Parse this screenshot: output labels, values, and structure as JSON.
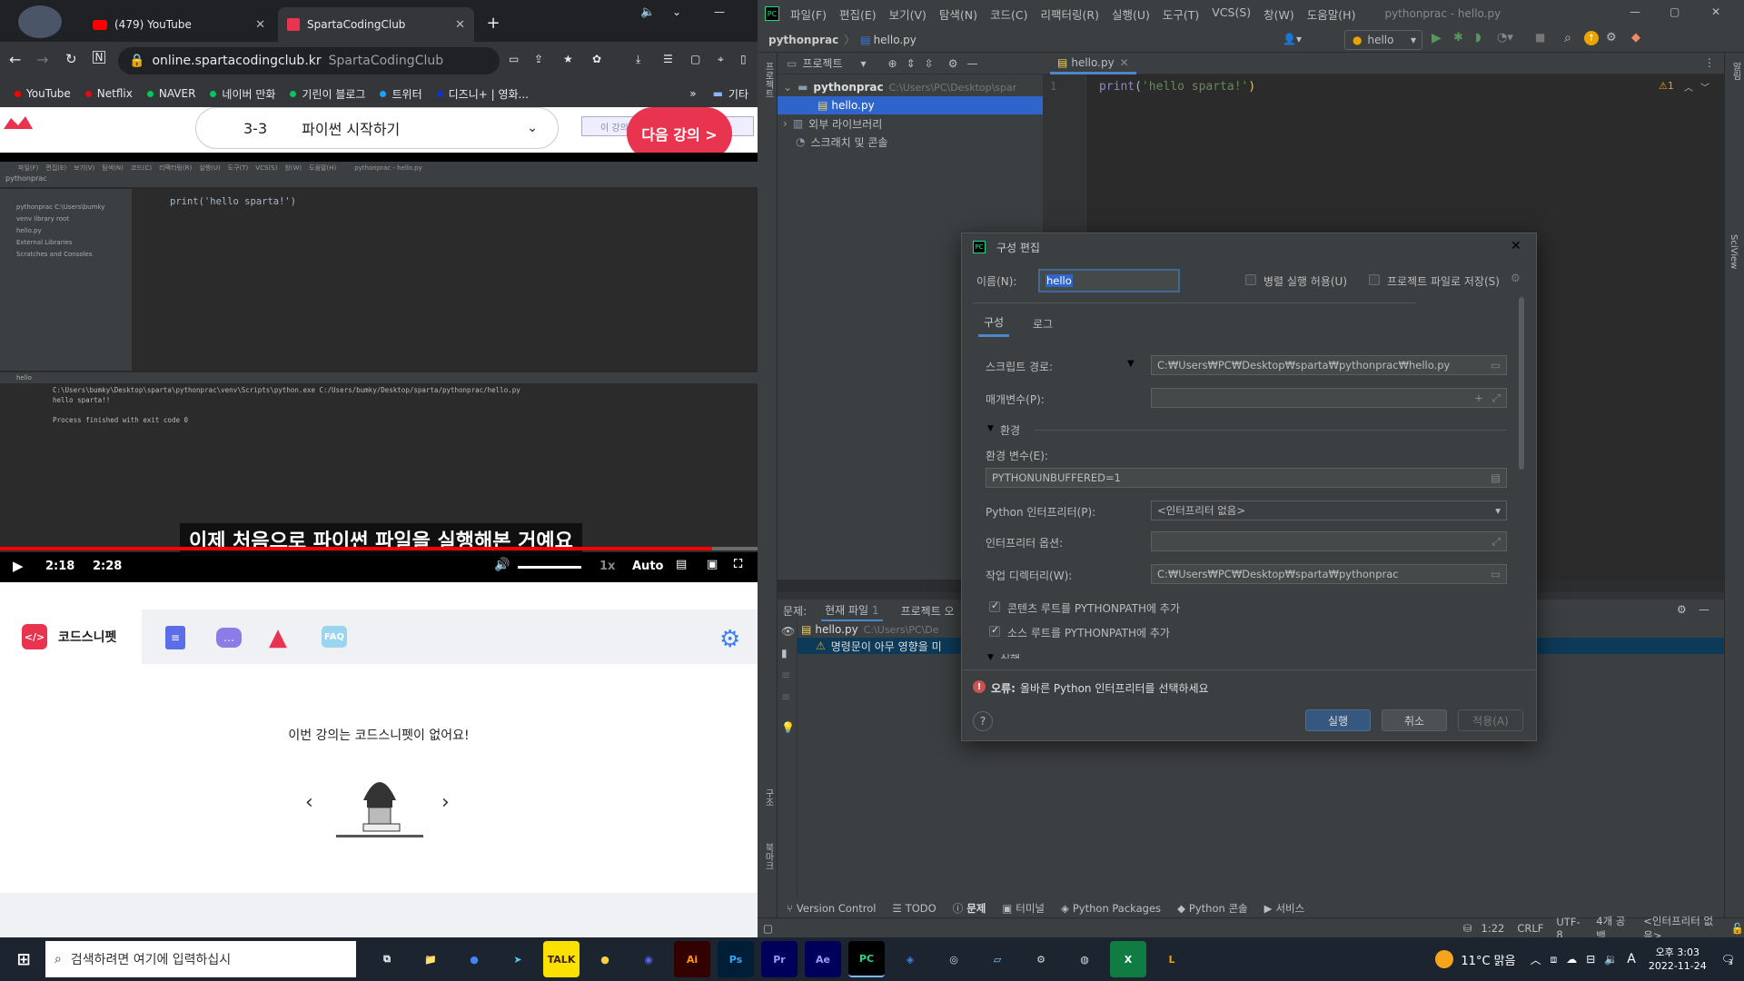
{
  "browser": {
    "tabs": [
      {
        "label": "(479) YouTube"
      },
      {
        "label": "SpartaCodingClub"
      }
    ],
    "url": "online.spartacodingclub.kr",
    "url_suffix": "SpartaCodingClub",
    "bookmarks": [
      {
        "label": "YouTube",
        "color": "#ff0000"
      },
      {
        "label": "Netflix",
        "color": "#e50914"
      },
      {
        "label": "NAVER",
        "color": "#03c75a"
      },
      {
        "label": "네이버 만화",
        "color": "#03c75a"
      },
      {
        "label": "기린이 블로그",
        "color": "#03c75a"
      },
      {
        "label": "트위터",
        "color": "#1da1f2"
      },
      {
        "label": "디즈니+ | 영화...",
        "color": "#1133cc"
      }
    ],
    "bookmark_more": "기타"
  },
  "lecture": {
    "number": "3-3",
    "title": "파이썬 시작하기",
    "next_label": "다음 강의 >",
    "banner_text": "이 강의를 내려받기 동영상"
  },
  "video": {
    "subtitle": "이제 처음으로 파이썬 파일을 실행해본 거예요",
    "time_current": "2:18",
    "time_total": "2:28",
    "speed": "1x",
    "quality": "Auto",
    "progress": 0.94,
    "inner": {
      "menu": [
        "파일(F)",
        "편집(E)",
        "보기(V)",
        "탐색(N)",
        "코드(C)",
        "리팩터링(R)",
        "실행(U)",
        "도구(T)",
        "VCS(S)",
        "창(W)",
        "도움말(H)"
      ],
      "window_title": "pythonprac - hello.py",
      "project": "pythonprac",
      "file": "hello.py",
      "tree": [
        "pythonprac  C:\\Users\\bumky",
        "venv  library root",
        "hello.py",
        "External Libraries",
        "Scratches and Consoles"
      ],
      "code_line": "print('hello sparta!')",
      "run_tab": "hello",
      "run_output": [
        "C:\\Users\\bumky\\Desktop\\sparta\\pythonprac\\venv\\Scripts\\python.exe C:/Users/bumky/Desktop/sparta/pythonprac/hello.py",
        "hello sparta!!",
        "",
        "Process finished with exit code 0"
      ]
    }
  },
  "snippet": {
    "tab_label": "코드스니펫",
    "tab_faq": "FAQ",
    "message": "이번 강의는 코드스니펫이 없어요!"
  },
  "ide": {
    "menu": [
      "파일(F)",
      "편집(E)",
      "보기(V)",
      "탐색(N)",
      "코드(C)",
      "리팩터링(R)",
      "실행(U)",
      "도구(T)",
      "VCS(S)",
      "창(W)",
      "도움말(H)"
    ],
    "window_title": "pythonprac - hello.py",
    "breadcrumb": [
      "pythonprac",
      "hello.py"
    ],
    "run_config": "hello",
    "project_tab": "프로젝트",
    "file_tab": "hello.py",
    "tree": [
      {
        "label": "pythonprac",
        "hint": "C:\\Users\\PC\\Desktop\\spar"
      },
      {
        "label": "hello.py",
        "hint": ""
      },
      {
        "label": "외부 라이브러리",
        "hint": ""
      },
      {
        "label": "스크래치 및 콘솔",
        "hint": ""
      }
    ],
    "code": {
      "line_no": "1",
      "text": "print('hello sparta!')",
      "warn": "⚠1"
    },
    "side_left": [
      "프로젝트",
      "구조",
      "북마크"
    ],
    "side_right": [
      "알림",
      "SciView"
    ],
    "problems": {
      "label": "문제:",
      "tabs": [
        "현재 파일",
        "프로젝트 오"
      ],
      "tab_count": "1",
      "file": "hello.py",
      "file_hint": "C:\\Users\\PC\\De",
      "warning": "명령문이 아무 영향을 미"
    },
    "bottom_tools": [
      "Version Control",
      "TODO",
      "문제",
      "터미널",
      "Python Packages",
      "Python 콘솔",
      "서비스"
    ],
    "status": [
      "1:22",
      "CRLF",
      "UTF-8",
      "4개 공백",
      "<인터프리터 없음>"
    ]
  },
  "dialog": {
    "title": "구성 편집",
    "name_label": "이름(N):",
    "name_value": "hello",
    "allow_parallel": "병렬 실행 허용(U)",
    "store_project": "프로젝트 파일로 저장(S)",
    "tabs": [
      "구성",
      "로그"
    ],
    "script_path_label": "스크립트 경로:",
    "script_path_value": "C:₩Users₩PC₩Desktop₩sparta₩pythonprac₩hello.py",
    "params_label": "매개변수(P):",
    "env_section": "환경",
    "env_vars_label": "환경 변수(E):",
    "env_vars_value": "PYTHONUNBUFFERED=1",
    "interpreter_label": "Python 인터프리터(P):",
    "interpreter_value": "<인터프리터 없음>",
    "interp_opts_label": "인터프리터 옵션:",
    "workdir_label": "작업 디렉터리(W):",
    "workdir_value": "C:₩Users₩PC₩Desktop₩sparta₩pythonprac",
    "content_roots": "콘텐츠 루트를 PYTHONPATH에 추가",
    "source_roots": "소스 루트를 PYTHONPATH에 추가",
    "exec_section": "실행",
    "error_prefix": "오류:",
    "error_text": "올바른 Python 인터프리터를 선택하세요",
    "run_btn": "실행",
    "cancel_btn": "취소",
    "apply_btn": "적용(A)"
  },
  "taskbar": {
    "search_placeholder": "검색하려면 여기에 입력하십시",
    "weather": "11°C 맑음",
    "time_ampm": "오후 3:03",
    "date": "2022-11-24",
    "ime": "A",
    "notif_count": "3",
    "apps": [
      {
        "name": "task-view",
        "label": "⧉",
        "bg": "transparent",
        "fg": "#fff"
      },
      {
        "name": "file-explorer",
        "label": "📁",
        "bg": "transparent",
        "fg": "#f5c242"
      },
      {
        "name": "chrome",
        "label": "●",
        "bg": "transparent",
        "fg": "#4285f4"
      },
      {
        "name": "app-bird",
        "label": "➤",
        "bg": "transparent",
        "fg": "#58c6f2"
      },
      {
        "name": "kakaotalk",
        "label": "TALK",
        "bg": "#fae100",
        "fg": "#3b1e1e"
      },
      {
        "name": "messenger",
        "label": "●",
        "bg": "transparent",
        "fg": "#f7d046"
      },
      {
        "name": "discord",
        "label": "◉",
        "bg": "transparent",
        "fg": "#5865f2"
      },
      {
        "name": "illustrator",
        "label": "Ai",
        "bg": "#330000",
        "fg": "#ff9a00"
      },
      {
        "name": "photoshop",
        "label": "Ps",
        "bg": "#001e36",
        "fg": "#31a8ff"
      },
      {
        "name": "premiere",
        "label": "Pr",
        "bg": "#00005b",
        "fg": "#9999ff"
      },
      {
        "name": "after-effects",
        "label": "Ae",
        "bg": "#00005b",
        "fg": "#9999ff"
      },
      {
        "name": "pycharm",
        "label": "PC",
        "bg": "#000",
        "fg": "#21d789"
      },
      {
        "name": "app-blue",
        "label": "◈",
        "bg": "transparent",
        "fg": "#3b82f6"
      },
      {
        "name": "steam",
        "label": "◎",
        "bg": "transparent",
        "fg": "#cfd8e3"
      },
      {
        "name": "app-paper",
        "label": "▱",
        "bg": "transparent",
        "fg": "#8cc8ff"
      },
      {
        "name": "app-gear",
        "label": "⚙",
        "bg": "transparent",
        "fg": "#ddd"
      },
      {
        "name": "obs",
        "label": "◍",
        "bg": "transparent",
        "fg": "#ddd"
      },
      {
        "name": "excel",
        "label": "X",
        "bg": "#107c41",
        "fg": "#fff"
      },
      {
        "name": "app-yellow",
        "label": "L",
        "bg": "transparent",
        "fg": "#e8a400"
      }
    ]
  },
  "colors": {
    "accent": "#4a88c7",
    "run_btn": "#365880",
    "youtube_red": "#ff0000",
    "sparta_red": "#e8344e"
  }
}
